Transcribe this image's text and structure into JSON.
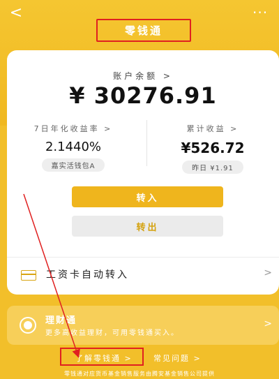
{
  "header": {
    "back_glyph": "<",
    "more_glyph": "···",
    "title": "零钱通"
  },
  "balance": {
    "label": "账户余额 >",
    "value": "¥ 30276.91"
  },
  "yield": {
    "label": "7日年化收益率 >",
    "value": "2.1440%",
    "fund": "嘉实活钱包A"
  },
  "earnings": {
    "label": "累计收益 >",
    "value": "¥526.72",
    "yesterday": "昨日 ¥1.91"
  },
  "actions": {
    "transfer_in": "转入",
    "transfer_out": "转出"
  },
  "auto_transfer": {
    "label": "工资卡自动转入",
    "chevron": ">"
  },
  "promo": {
    "title": "理财通",
    "subtitle": "更多高收益理财，可用零钱通买入。",
    "chevron": ">"
  },
  "links": {
    "learn_more": "了解零钱通 >",
    "faq": "常见问题 >"
  },
  "footer": {
    "note": "零钱通对应货币基金销售服务由腾安基金销售公司提供"
  },
  "colors": {
    "brand": "#f2bf2a",
    "annotation": "#e02020"
  }
}
